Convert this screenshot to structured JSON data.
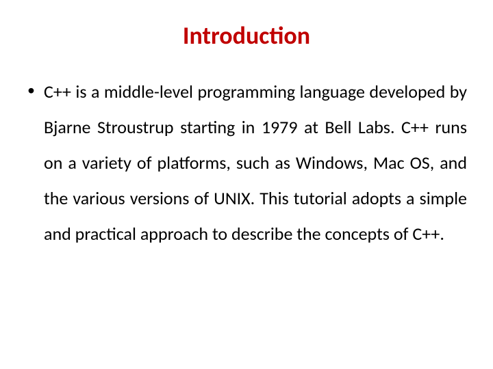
{
  "title": "Introduction",
  "bullets": [
    {
      "marker": "•",
      "text": "C++ is a middle-level programming language developed by Bjarne Stroustrup starting in 1979 at Bell Labs. C++ runs on a variety of platforms, such as Windows, Mac OS, and the various versions of UNIX. This tutorial adopts a simple and practical approach to describe the concepts of C++."
    }
  ]
}
